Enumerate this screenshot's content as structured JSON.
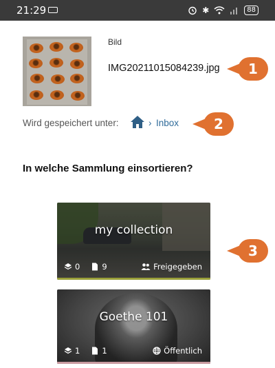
{
  "status_bar": {
    "time": "21:29",
    "battery": "88",
    "icons": [
      "sim-card-icon",
      "bluetooth-icon",
      "wifi-icon",
      "signal-icon",
      "battery-icon"
    ]
  },
  "file": {
    "kind_label": "Bild",
    "name": "IMG20211015084239.jpg"
  },
  "save_location": {
    "label": "Wird gespeichert unter:",
    "separator": "›",
    "folder": "Inbox",
    "home_icon": "home-icon"
  },
  "question": "In welche Sammlung einsortieren?",
  "annotations": [
    "1",
    "2",
    "3"
  ],
  "annotation_color": "#e07130",
  "link_color": "#2f6b9a",
  "collections": [
    {
      "title": "my collection",
      "subcollections": "0",
      "documents": "9",
      "visibility": "Freigegeben",
      "visibility_icon": "people-icon"
    },
    {
      "title": "Goethe 101",
      "subcollections": "1",
      "documents": "1",
      "visibility": "Öffentlich",
      "visibility_icon": "globe-icon"
    }
  ]
}
